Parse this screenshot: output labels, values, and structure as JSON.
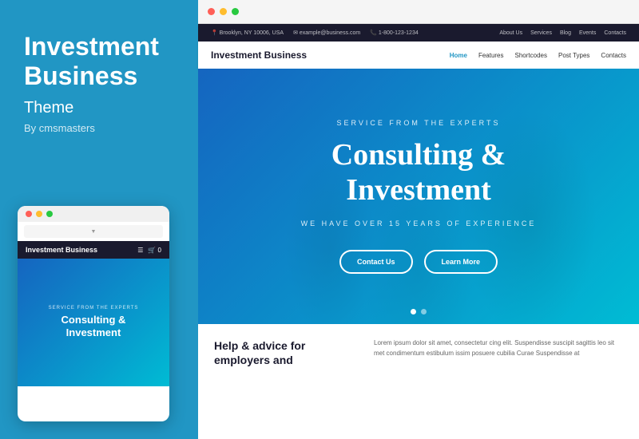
{
  "left": {
    "title": "Investment Business",
    "subtitle": "Theme",
    "author": "By cmsmasters"
  },
  "mobile": {
    "dots": [
      "red",
      "yellow",
      "green"
    ],
    "url_text": "▼",
    "header_title": "Investment Business",
    "hero_eyebrow": "SERVICE FROM THE EXPERTS",
    "hero_title_line1": "Consulting &",
    "hero_title_line2": "Investment"
  },
  "browser": {
    "dots": [
      "red",
      "yellow",
      "green"
    ],
    "topbar": {
      "left": [
        "📍 Brooklyn, NY 10006, USA",
        "✉ example@business.com",
        "📞 1-800-123-1234"
      ],
      "right": [
        "About Us",
        "Services",
        "Blog",
        "Events",
        "Contacts"
      ]
    },
    "navbar": {
      "brand": "Investment Business",
      "links": [
        "Home",
        "Features",
        "Shortcodes",
        "Post Types",
        "Contacts"
      ]
    },
    "hero": {
      "eyebrow": "SERVICE FROM THE EXPERTS",
      "title_line1": "Consulting &",
      "title_line2": "Investment",
      "tagline": "WE HAVE OVER 15 YEARS OF EXPERIENCE",
      "btn_contact": "Contact Us",
      "btn_learn": "Learn More"
    },
    "bottom": {
      "left_title_line1": "Help & advice for",
      "left_title_line2": "employers and",
      "right_text": "Lorem ipsum dolor sit amet, consectetur cing elit. Suspendisse suscipit sagittis leo sit met condimentum estibulum issim posuere cubilia Curae Suspendisse at"
    }
  }
}
